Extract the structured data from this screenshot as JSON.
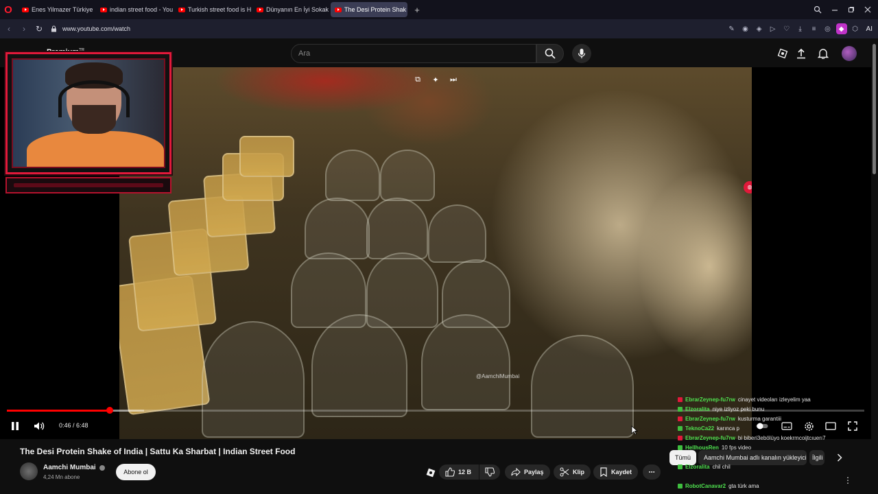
{
  "browser": {
    "tabs": [
      {
        "label": "Enes Yilmazer Türkiye - Yo"
      },
      {
        "label": "indian street food - YouTu"
      },
      {
        "label": "Turkish street food is HEA"
      },
      {
        "label": "Dünyanın En İyi Sokak Yen"
      },
      {
        "label": "The Desi Protein Shak"
      }
    ],
    "new_tab": "+",
    "url": "www.youtube.com/watch",
    "ai_label": "AI"
  },
  "youtube": {
    "logo_label": "Premium",
    "logo_region": "TR",
    "search_placeholder": "Ara"
  },
  "player": {
    "time": "0:46 / 6:48",
    "progress_fraction": 0.12,
    "watermark": "@AamchiMumbai"
  },
  "video": {
    "title": "The Desi Protein Shake of India | Sattu Ka Sharbat | Indian Street Food",
    "channel": "Aamchi Mumbai",
    "subscribers": "4,24 Mn abone",
    "subscribe_label": "Abone ol",
    "likes": "12 B",
    "share_label": "Paylaş",
    "clip_label": "Klip",
    "save_label": "Kaydet",
    "chip_all": "Tümü",
    "chip_uploader": "Aamchi Mumbai adlı kanalın yükleyiciden",
    "chip_related": "İlgili"
  },
  "chat": {
    "messages": [
      {
        "user": "EbrarZeynep-fu7rw",
        "text": "cinayet videoları izleyelim yaa",
        "badge": "#e1193a"
      },
      {
        "user": "Elzoralita",
        "text": "niye izliyoz peki bunu",
        "badge": "#3fbf3f"
      },
      {
        "user": "EbrarZeynep-fu7rw",
        "text": "kusturma garantiii",
        "badge": "#e1193a"
      },
      {
        "user": "TeknoCa22",
        "text": "karınca p",
        "badge": "#3fbf3f"
      },
      {
        "user": "EbrarZeynep-fu7rw",
        "text": "bi biberi3ebölüyo koekrmcoijtcıuerı7",
        "badge": "#e1193a"
      },
      {
        "user": "HellhousRen",
        "text": "10 fps video",
        "badge": "#3fbf3f"
      },
      {
        "user": "Elzoralita",
        "text": "chil chil",
        "badge": "#3fbf3f"
      },
      {
        "user": "RobotCanavar2",
        "text": "gta türk ama",
        "badge": "#3fbf3f"
      }
    ]
  }
}
